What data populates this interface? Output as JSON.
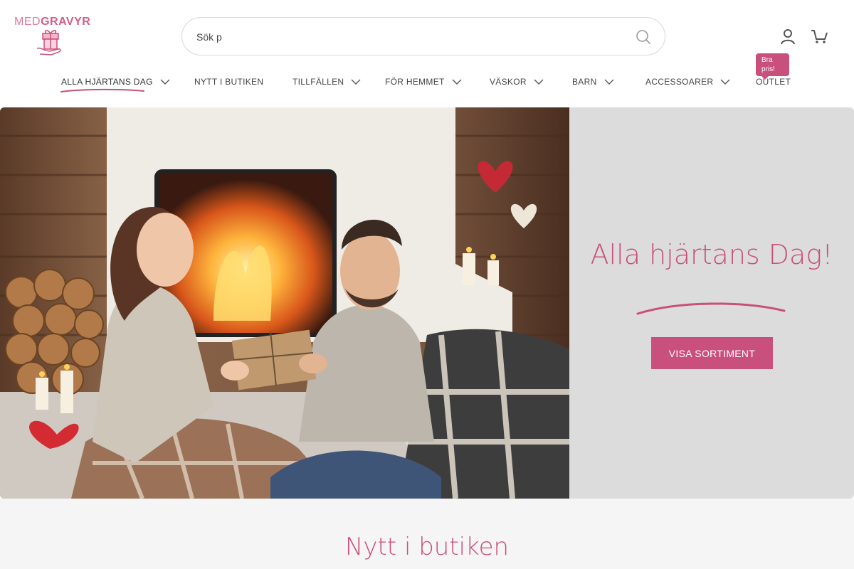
{
  "brand": {
    "logo_part1": "MED",
    "logo_part2": "GRAVYR"
  },
  "search": {
    "value": "Sök p",
    "placeholder": ""
  },
  "nav": {
    "items": [
      {
        "label": "ALLA HJÄRTANS DAG",
        "has_dropdown": true,
        "active": true
      },
      {
        "label": "NYTT I BUTIKEN",
        "has_dropdown": false
      },
      {
        "label": "TILLFÄLLEN",
        "has_dropdown": true
      },
      {
        "label": "FÖR HEMMET",
        "has_dropdown": true
      },
      {
        "label": "VÄSKOR",
        "has_dropdown": true
      },
      {
        "label": "BARN",
        "has_dropdown": true
      },
      {
        "label": "ACCESSOARER",
        "has_dropdown": true
      },
      {
        "label": "OUTLET",
        "has_dropdown": false
      }
    ],
    "outlet_badge": "Bra pris!"
  },
  "hero": {
    "title": "Alla hjärtans Dag!",
    "button_label": "VISA SORTIMENT"
  },
  "section": {
    "title": "Nytt i butiken"
  },
  "icons": {
    "search": "search-icon",
    "account": "account-icon",
    "cart": "cart-icon",
    "chevron": "chevron-down-icon"
  },
  "colors": {
    "accent": "#c94f7c",
    "hero_panel_bg": "#dcdcdc",
    "section_bg": "#f5f5f5"
  }
}
